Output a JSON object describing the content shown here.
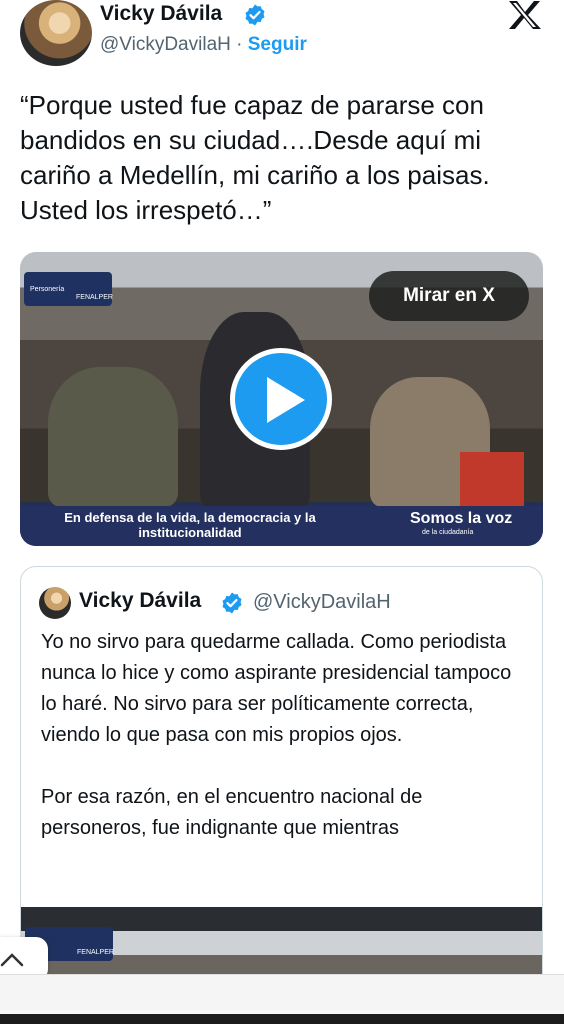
{
  "author": {
    "name": "Vicky Dávila",
    "handle": "@VickyDavilaH",
    "separator": "·",
    "follow_label": "Seguir"
  },
  "tweet": {
    "text": "“Porque usted fue capaz de pararse con bandidos en su ciudad….Desde aquí mi cariño a Medellín, mi cariño a los paisas. Usted los irrespetó…”"
  },
  "video": {
    "watch_label": "Mirar en X",
    "logo_left": "Personería",
    "logo_right": "FENALPER",
    "banner_left": "En defensa de la vida, la democracia y la institucionalidad",
    "banner_right": "Somos la voz",
    "banner_right_sub": "de la ciudadanía"
  },
  "quote": {
    "name": "Vicky Dávila",
    "handle": "@VickyDavilaH",
    "paragraph_1": "Yo no sirvo para quedarme callada. Como periodista nunca lo hice y como aspirante presidencial tampoco lo haré. No sirvo para ser políticamente correcta, viendo lo que pasa con mis propios ojos.",
    "paragraph_2": "Por esa razón, en el encuentro nacional de personeros, fue indignante que mientras",
    "media_logo_right": "FENALPER"
  },
  "colors": {
    "accent": "#1d9bf0",
    "text": "#0f1419",
    "muted": "#536471"
  },
  "icons": [
    "verified-icon",
    "x-logo-icon",
    "play-icon",
    "chevron-up-icon"
  ]
}
